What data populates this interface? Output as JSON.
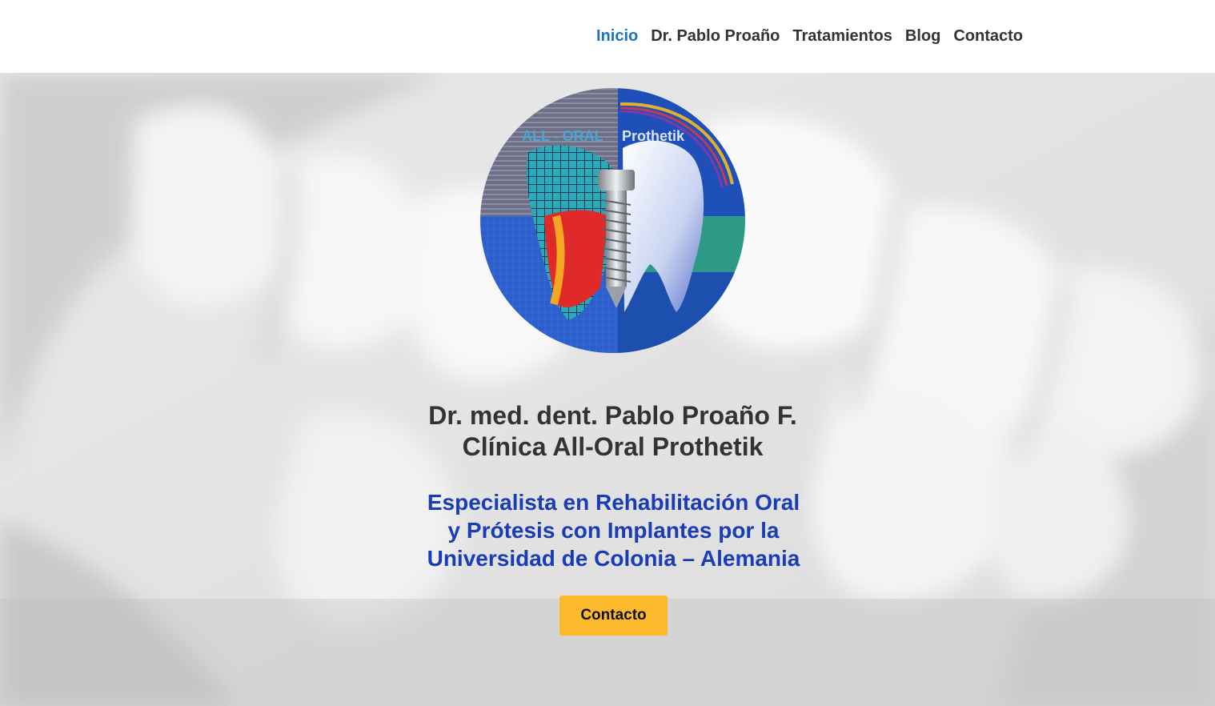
{
  "nav": {
    "items": [
      {
        "label": "Inicio",
        "active": true
      },
      {
        "label": "Dr. Pablo Proaño",
        "active": false
      },
      {
        "label": "Tratamientos",
        "active": false
      },
      {
        "label": "Blog",
        "active": false
      },
      {
        "label": "Contacto",
        "active": false
      }
    ]
  },
  "logo": {
    "text_left": "ALL - ORAL",
    "text_right": "Prothetik"
  },
  "hero": {
    "title_lines": [
      "Dr. med. dent. Pablo Proaño F.",
      "Clínica All-Oral Prothetik"
    ],
    "subtitle_lines": [
      "Especialista en Rehabilitación Oral",
      "y Prótesis con Implantes por la",
      "Universidad de Colonia – Alemania"
    ],
    "cta_label": "Contacto"
  },
  "colors": {
    "nav_active": "#1e73be",
    "nav_text": "#333333",
    "title": "#333333",
    "subtitle": "#1a3db5",
    "cta_bg": "#fbb92b"
  }
}
